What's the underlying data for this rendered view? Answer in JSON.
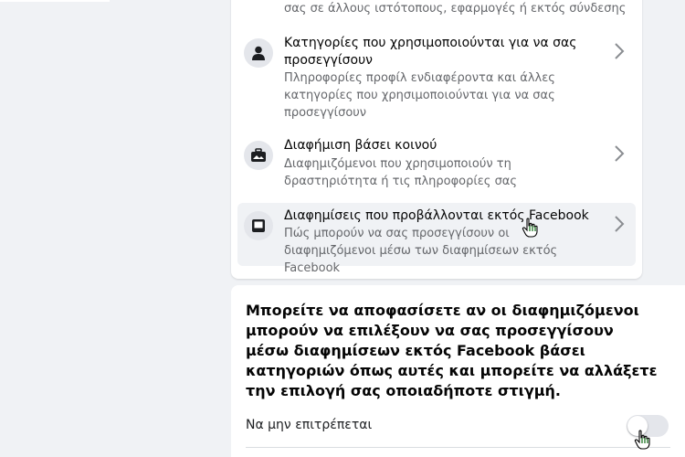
{
  "top_item": {
    "desc": "σας σε άλλους ιστότοπους, εφαρμογές ή εκτός σύνδεσης"
  },
  "items": [
    {
      "icon": "person-icon",
      "title": "Κατηγορίες που χρησιμοποιούνται για να σας προσεγγίσουν",
      "desc": "Πληροφορίες προφίλ ενδιαφέροντα και άλλες κατηγορίες που χρησιμοποιούνται για να σας προσεγγίσουν"
    },
    {
      "icon": "briefcase-icon",
      "title": "Διαφήμιση βάσει κοινού",
      "desc": "Διαφημιζόμενοι που χρησιμοποιούν τη δραστηριότητα ή τις πληροφορίες σας"
    },
    {
      "icon": "tablet-icon",
      "title": "Διαφημίσεις που προβάλλονται εκτός Facebook",
      "desc": "Πώς μπορούν να σας προσεγγίσουν οι διαφημιζόμενοι μέσω των διαφημίσεων εκτός Facebook"
    }
  ],
  "panel": {
    "heading": "Μπορείτε να αποφασίσετε αν οι διαφημιζόμενοι μπορούν να επιλέξουν να σας προσεγγίσουν μέσω διαφημίσεων εκτός Facebook βάσει κατηγοριών όπως αυτές και μπορείτε να αλλάξετε την επιλογή σας οποιαδήποτε στιγμή.",
    "option_label": "Να μην επιτρέπεται",
    "toggle_on": false
  }
}
